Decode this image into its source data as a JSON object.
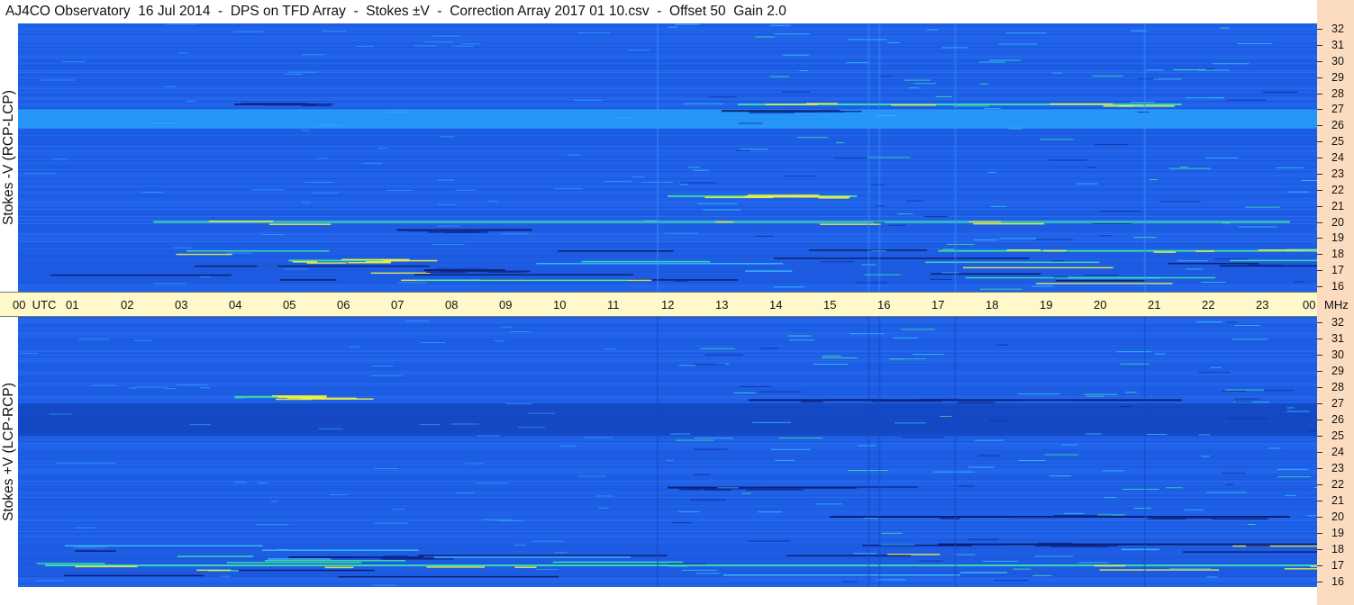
{
  "header": {
    "title": "AJ4CO Observatory  16 Jul 2014  -  DPS on TFD Array  -  Stokes ±V  -  Correction Array 2017 01 10.csv  -  Offset 50  Gain 2.0"
  },
  "colors": {
    "background_blue": "#1e5fe6",
    "band_light": "#2aa8ff",
    "emission_yellow": "#f4f43c",
    "emission_green": "#3cf0a0",
    "emission_dark": "#0a1460",
    "time_axis_bg": "#fff8c8",
    "freq_axis_bg": "#fcdcc0"
  },
  "chart_data": [
    {
      "type": "heatmap",
      "panel": "top",
      "ylabel": "Stokes -V (RCP-LCP)",
      "x_ticks": [
        "00",
        "01",
        "02",
        "03",
        "04",
        "05",
        "06",
        "07",
        "08",
        "09",
        "10",
        "11",
        "12",
        "13",
        "14",
        "15",
        "16",
        "17",
        "18",
        "19",
        "20",
        "21",
        "22",
        "23",
        "00"
      ],
      "x_unit": "UTC",
      "xlim": [
        0,
        24
      ],
      "y_ticks": [
        16,
        17,
        18,
        19,
        20,
        21,
        22,
        23,
        24,
        25,
        26,
        27,
        28,
        29,
        30,
        31,
        32
      ],
      "y_unit": "MHz",
      "ylim": [
        16,
        32
      ],
      "features": [
        {
          "kind": "band",
          "f_lo": 25.8,
          "f_hi": 27.0,
          "t_start": 0,
          "t_end": 24,
          "level": "bright"
        },
        {
          "kind": "band",
          "f_lo": 16.2,
          "f_hi": 18.3,
          "t_start": 0,
          "t_end": 24,
          "level": "mixed"
        },
        {
          "kind": "burst",
          "f": 27.3,
          "t_start": 13.3,
          "t_end": 21.5,
          "level": "bright"
        },
        {
          "kind": "burst",
          "f": 26.9,
          "t_start": 13.0,
          "t_end": 15.0,
          "level": "dark"
        },
        {
          "kind": "burst",
          "f": 21.6,
          "t_start": 12.0,
          "t_end": 15.5,
          "level": "bright"
        },
        {
          "kind": "burst",
          "f": 20.0,
          "t_start": 2.5,
          "t_end": 23.5,
          "level": "bright"
        },
        {
          "kind": "burst",
          "f": 17.6,
          "t_start": 5.0,
          "t_end": 7.2,
          "level": "bright"
        },
        {
          "kind": "burst",
          "f": 17.0,
          "t_start": 7.5,
          "t_end": 9.0,
          "level": "dark"
        },
        {
          "kind": "burst",
          "f": 18.2,
          "t_start": 17.0,
          "t_end": 24.0,
          "level": "bright"
        },
        {
          "kind": "burst",
          "f": 27.3,
          "t_start": 4.0,
          "t_end": 5.5,
          "level": "dark"
        },
        {
          "kind": "burst",
          "f": 19.5,
          "t_start": 7.0,
          "t_end": 9.5,
          "level": "dark"
        }
      ]
    },
    {
      "type": "heatmap",
      "panel": "bottom",
      "ylabel": "Stokes +V (LCP-RCP)",
      "x_ticks": [
        "00",
        "01",
        "02",
        "03",
        "04",
        "05",
        "06",
        "07",
        "08",
        "09",
        "10",
        "11",
        "12",
        "13",
        "14",
        "15",
        "16",
        "17",
        "18",
        "19",
        "20",
        "21",
        "22",
        "23",
        "00"
      ],
      "x_unit": "UTC",
      "xlim": [
        0,
        24
      ],
      "y_ticks": [
        16,
        17,
        18,
        19,
        20,
        21,
        22,
        23,
        24,
        25,
        26,
        27,
        28,
        29,
        30,
        31,
        32
      ],
      "y_unit": "MHz",
      "ylim": [
        16,
        32
      ],
      "features": [
        {
          "kind": "band",
          "f_lo": 25.0,
          "f_hi": 27.0,
          "t_start": 0,
          "t_end": 24,
          "level": "dark"
        },
        {
          "kind": "band",
          "f_lo": 16.3,
          "f_hi": 18.3,
          "t_start": 0,
          "t_end": 24,
          "level": "mixed"
        },
        {
          "kind": "burst",
          "f": 27.2,
          "t_start": 13.5,
          "t_end": 21.5,
          "level": "dark"
        },
        {
          "kind": "burst",
          "f": 21.8,
          "t_start": 12.0,
          "t_end": 15.5,
          "level": "dark"
        },
        {
          "kind": "burst",
          "f": 20.0,
          "t_start": 15.0,
          "t_end": 23.5,
          "level": "dark"
        },
        {
          "kind": "burst",
          "f": 17.5,
          "t_start": 5.0,
          "t_end": 7.5,
          "level": "dark"
        },
        {
          "kind": "burst",
          "f": 17.0,
          "t_start": 0.5,
          "t_end": 24.0,
          "level": "bright"
        },
        {
          "kind": "burst",
          "f": 18.3,
          "t_start": 17.0,
          "t_end": 24.0,
          "level": "dark"
        },
        {
          "kind": "burst",
          "f": 27.4,
          "t_start": 4.0,
          "t_end": 5.5,
          "level": "bright"
        }
      ]
    }
  ],
  "time_axis": {
    "labels": [
      "00  UTC",
      "01",
      "02",
      "03",
      "04",
      "05",
      "06",
      "07",
      "08",
      "09",
      "10",
      "11",
      "12",
      "13",
      "14",
      "15",
      "16",
      "17",
      "18",
      "19",
      "20",
      "21",
      "22",
      "23",
      "00"
    ],
    "unit_label": "MHz"
  }
}
